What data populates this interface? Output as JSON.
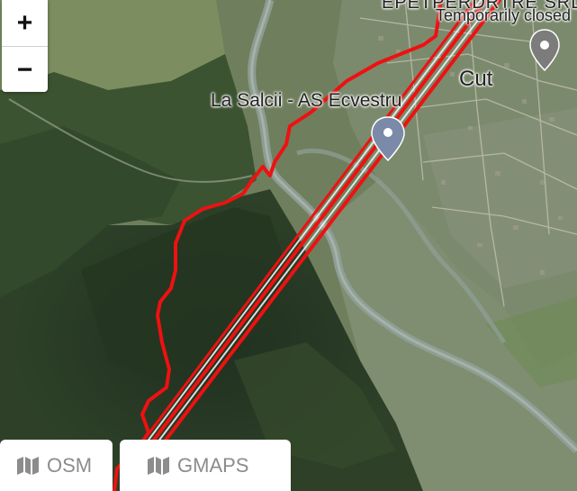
{
  "map": {
    "places": {
      "business_partial": "EPETPERDRTRE SRL",
      "business_status": "Temporarily closed",
      "village": "Cut",
      "poi": "La Salcii - AS Ecvestru"
    }
  },
  "controls": {
    "zoom_in": "+",
    "zoom_out": "−"
  },
  "layer_tabs": [
    {
      "label": "OSM",
      "icon": "map-icon"
    },
    {
      "label": "GMAPS",
      "icon": "map-icon"
    }
  ],
  "colors": {
    "track": "#ee1111",
    "forest": "#2b3d26",
    "fields": "#7d8d6e",
    "river": "#8a9c8c"
  }
}
